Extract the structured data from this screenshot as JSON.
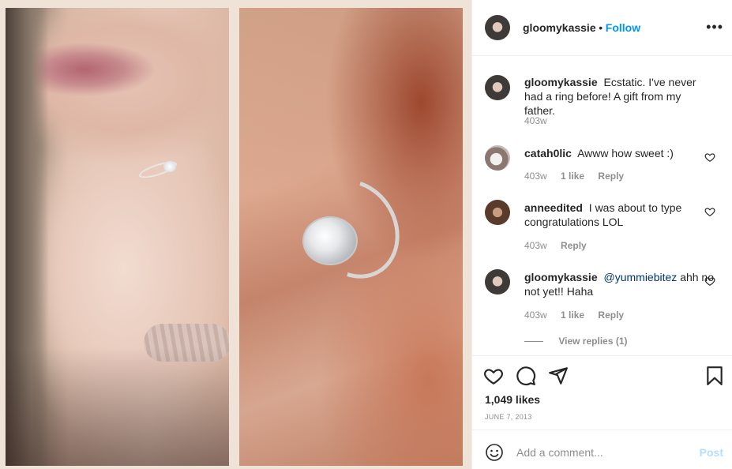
{
  "post": {
    "author": "gloomykassie",
    "follow_label": "Follow",
    "separator": "•",
    "more_label": "•••"
  },
  "caption": {
    "username": "gloomykassie",
    "text": "Ecstatic. I've never had a ring before! A gift from my father.",
    "time": "403w"
  },
  "comments": [
    {
      "username": "catah0lic",
      "text": "Awww how sweet :)",
      "time": "403w",
      "likes": "1 like",
      "reply": "Reply"
    },
    {
      "username": "anneedited",
      "text": "I was about to type congratulations LOL",
      "time": "403w",
      "reply": "Reply"
    },
    {
      "username": "gloomykassie",
      "mention": "@yummiebitez",
      "text": "ahh no not yet!! Haha",
      "time": "403w",
      "likes": "1 like",
      "reply": "Reply"
    }
  ],
  "view_replies": "View replies (1)",
  "engagement": {
    "likes": "1,049 likes",
    "date": "JUNE 7, 2013"
  },
  "composer": {
    "placeholder": "Add a comment...",
    "post_label": "Post"
  },
  "colors": {
    "accent": "#0095f6",
    "post_disabled": "#b2dffc",
    "muted": "#8e8e8e",
    "text": "#262626"
  },
  "icons": [
    "more-icon",
    "heart-icon",
    "comment-icon",
    "share-icon",
    "bookmark-icon",
    "emoji-icon"
  ]
}
